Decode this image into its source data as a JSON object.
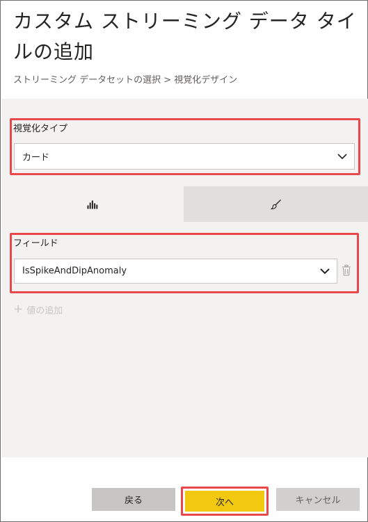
{
  "dialog": {
    "title": "カスタム ストリーミング データ タイルの追加",
    "breadcrumb": "ストリーミング データセットの選択 > 視覚化デザイン"
  },
  "visualization": {
    "label": "視覚化タイプ",
    "selected": "カード"
  },
  "tabs": [
    {
      "icon": "bar-chart-icon",
      "name": "fields"
    },
    {
      "icon": "paintbrush-icon",
      "name": "format"
    }
  ],
  "fields": {
    "label": "フィールド",
    "selected": "IsSpikeAndDipAnomaly",
    "add_value": "値の追加"
  },
  "buttons": {
    "back": "戻る",
    "next": "次へ",
    "cancel": "キャンセル"
  },
  "colors": {
    "accent_yellow": "#f2c811",
    "highlight_red": "#e8484c",
    "panel_bg": "#f3f2f1"
  }
}
